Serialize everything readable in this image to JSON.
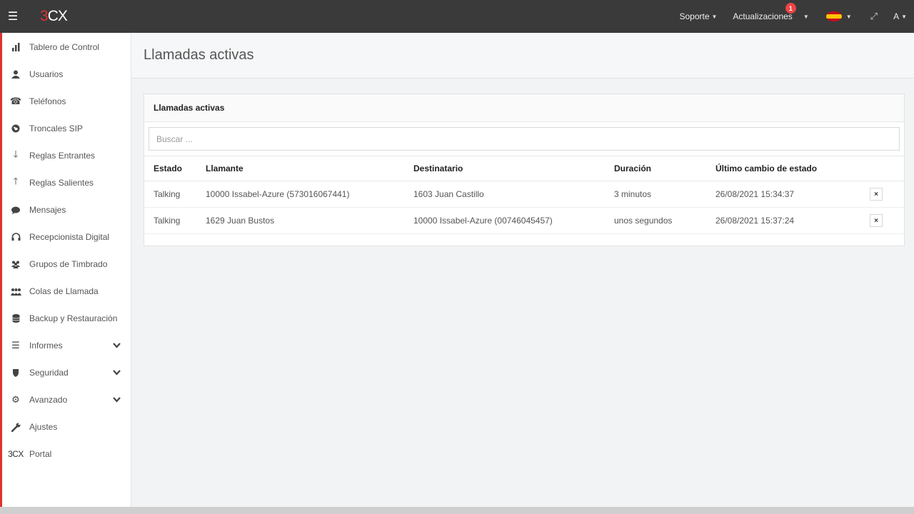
{
  "topbar": {
    "menu_icon": "hamburger-icon",
    "logo_three": "3",
    "logo_cx": "CX",
    "support_label": "Soporte",
    "updates_label": "Actualizaciones",
    "updates_badge": "1",
    "language_icon": "spain-flag-icon",
    "fullscreen_icon": "expand-icon",
    "user_label": "A"
  },
  "sidebar": {
    "items": [
      {
        "label": "Tablero de Control",
        "icon": "bar-chart-icon"
      },
      {
        "label": "Usuarios",
        "icon": "user-icon"
      },
      {
        "label": "Teléfonos",
        "icon": "phone-icon"
      },
      {
        "label": "Troncales SIP",
        "icon": "globe-icon"
      },
      {
        "label": "Reglas Entrantes",
        "icon": "arrow-down-icon"
      },
      {
        "label": "Reglas Salientes",
        "icon": "arrow-up-icon"
      },
      {
        "label": "Mensajes",
        "icon": "chat-icon"
      },
      {
        "label": "Recepcionista Digital",
        "icon": "headset-icon"
      },
      {
        "label": "Grupos de Timbrado",
        "icon": "group-icon"
      },
      {
        "label": "Colas de Llamada",
        "icon": "queue-icon"
      },
      {
        "label": "Backup y Restauración",
        "icon": "database-icon"
      },
      {
        "label": "Informes",
        "icon": "list-icon"
      },
      {
        "label": "Seguridad",
        "icon": "shield-icon"
      },
      {
        "label": "Avanzado",
        "icon": "gear-icon"
      },
      {
        "label": "Ajustes",
        "icon": "wrench-icon"
      },
      {
        "label": "Portal",
        "icon": "3cx-logo-icon"
      }
    ],
    "portal_logo": "3CX"
  },
  "main": {
    "page_title": "Llamadas activas",
    "panel_title": "Llamadas activas",
    "search_placeholder": "Buscar ...",
    "columns": [
      "Estado",
      "Llamante",
      "Destinatario",
      "Duración",
      "Último cambio de estado"
    ],
    "rows": [
      {
        "estado": "Talking",
        "llamante": "10000 Issabel-Azure (573016067441)",
        "destinatario": "1603 Juan Castillo",
        "duracion": "3 minutos",
        "cambio": "26/08/2021 15:34:37",
        "action": "×"
      },
      {
        "estado": "Talking",
        "llamante": "1629 Juan Bustos",
        "destinatario": "10000 Issabel-Azure (00746045457)",
        "duracion": "unos segundos",
        "cambio": "26/08/2021 15:37:24",
        "action": "×"
      }
    ]
  },
  "colors": {
    "topbar_bg": "#3a3a3a",
    "brand_red": "#dd3333",
    "badge_red": "#ee4444",
    "page_bg": "#f1f3f4"
  }
}
